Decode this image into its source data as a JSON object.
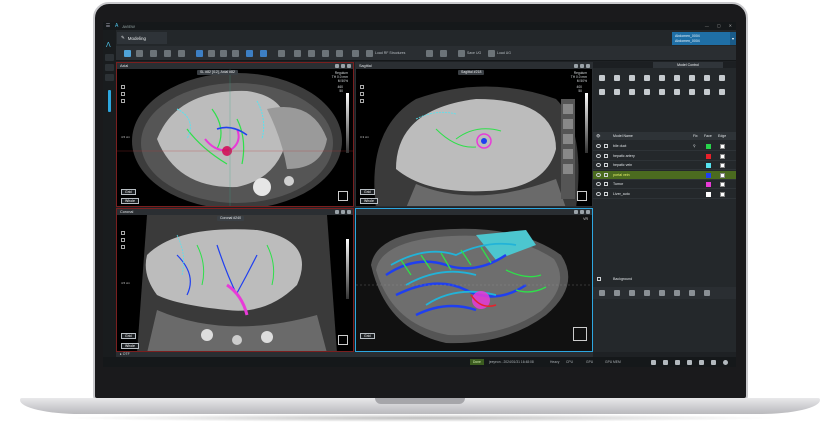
{
  "app": {
    "brand": "A",
    "title": "AVIEW",
    "window_controls": [
      "—",
      "▢",
      "✕"
    ]
  },
  "tabs": [
    {
      "label": "Modeling",
      "icon": "pencil-icon"
    }
  ],
  "dataset": {
    "line1": "Abdomen_0004",
    "line2": "Abdomen_0004"
  },
  "toolbar": {
    "load_label": "Load RF Structures",
    "save_label": "Save UG",
    "load2_label": "Load UG"
  },
  "viewports": {
    "axial": {
      "title": "Axial",
      "slice_pill": "SL #82 [I12], Axial #82",
      "info": "Regulum\nTH 0.0 mm\nM 50%",
      "wl": "460\n50",
      "scale": "4.5 cm",
      "grid": "Grid",
      "whole": "Whole"
    },
    "sagittal": {
      "title": "Sagittal",
      "slice_pill": "Sagittal #218",
      "info": "Regulum\nTH 0.0 mm\nM 50%",
      "wl": "400\n50",
      "scale": "3.3 cm",
      "grid": "Grid",
      "whole": "Whole"
    },
    "coronal": {
      "title": "Coronal",
      "slice_pill": "Coronal #240",
      "scale": "4.5 cm",
      "grid": "Grid",
      "whole": "Whole"
    },
    "three_d": {
      "title": "",
      "corner": "VR",
      "grid": "Grid"
    }
  },
  "panel": {
    "tabs": [
      "",
      "",
      "Model Control"
    ],
    "table": {
      "col_name": "Model Name",
      "col_fix": "Fix",
      "col_face": "Face",
      "col_edge": "Edge"
    },
    "models": [
      {
        "name": "bile duct",
        "face": "#27d34a",
        "selected": false,
        "fix": "⚲"
      },
      {
        "name": "hepatic artery",
        "face": "#e8202a",
        "selected": false,
        "fix": ""
      },
      {
        "name": "hepatic vein",
        "face": "#56e3f0",
        "selected": false,
        "fix": ""
      },
      {
        "name": "portal vein",
        "face": "#1f3ff0",
        "selected": true,
        "fix": ""
      },
      {
        "name": "Tumor",
        "face": "#e83ad8",
        "selected": false,
        "fix": ""
      },
      {
        "name": "Liver_auto",
        "face": "#ffffff",
        "selected": false,
        "fix": ""
      }
    ],
    "background_label": "Background"
  },
  "bottom": {
    "otf_label": "OTF",
    "status_done": "Done",
    "status_user": "jeeyeon - 2024/01/31 16:48:08",
    "mem": "Heavy",
    "cpu": "CPU",
    "gpu": "GPU",
    "gpu_mem": "GPU MEM"
  },
  "colors": {
    "accent": "#4fc3e8",
    "viewport_border_active": "#2da7e0",
    "liver": "#bcbcbc"
  }
}
